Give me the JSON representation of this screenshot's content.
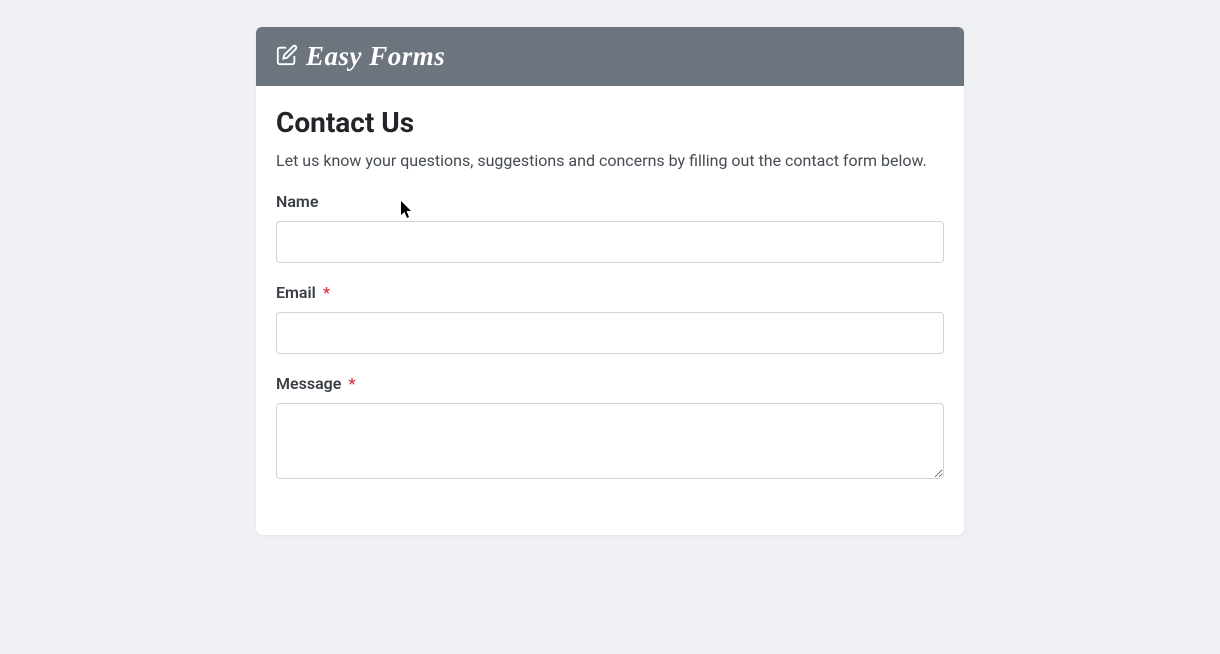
{
  "header": {
    "brand_text": "Easy Forms"
  },
  "form": {
    "title": "Contact Us",
    "description": "Let us know your questions, suggestions and concerns by filling out the contact form below.",
    "fields": {
      "name": {
        "label": "Name",
        "required": false,
        "value": ""
      },
      "email": {
        "label": "Email",
        "required": true,
        "value": ""
      },
      "message": {
        "label": "Message",
        "required": true,
        "value": ""
      }
    },
    "required_marker": "*"
  }
}
